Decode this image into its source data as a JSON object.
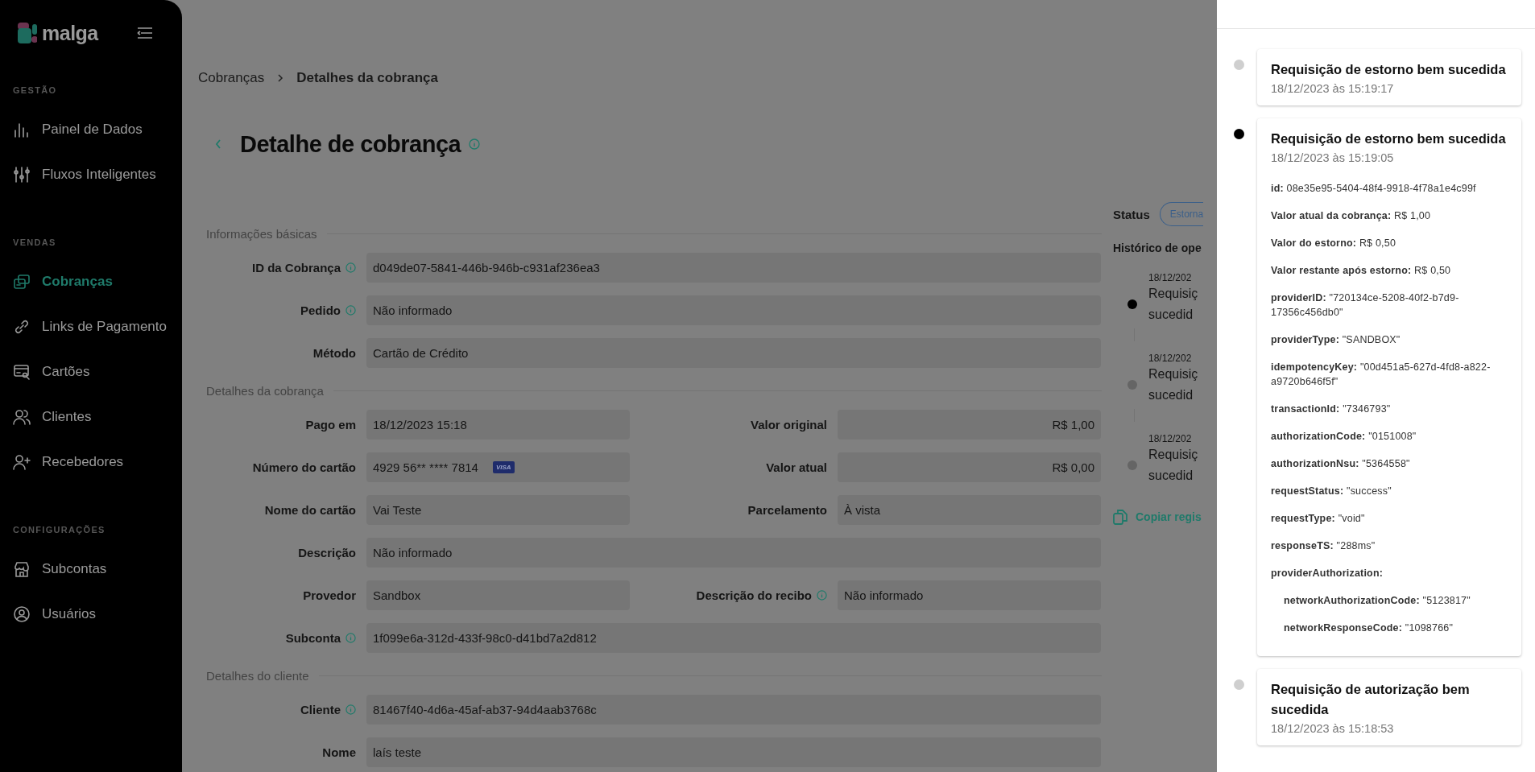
{
  "sidebar": {
    "logo": "malga",
    "sections": [
      {
        "title": "GESTÃO",
        "items": [
          {
            "label": "Painel de Dados",
            "selected": false
          },
          {
            "label": "Fluxos Inteligentes",
            "selected": false
          }
        ]
      },
      {
        "title": "VENDAS",
        "items": [
          {
            "label": "Cobranças",
            "selected": true
          },
          {
            "label": "Links de Pagamento",
            "selected": false
          },
          {
            "label": "Cartões",
            "selected": false
          },
          {
            "label": "Clientes",
            "selected": false
          },
          {
            "label": "Recebedores",
            "selected": false
          }
        ]
      },
      {
        "title": "CONFIGURAÇÕES",
        "items": [
          {
            "label": "Subcontas",
            "selected": false
          },
          {
            "label": "Usuários",
            "selected": false
          }
        ]
      }
    ]
  },
  "breadcrumb": [
    {
      "label": "Cobranças",
      "current": false
    },
    {
      "label": "Detalhes da cobrança",
      "current": true
    }
  ],
  "title": "Detalhe de cobrança",
  "sections": [
    {
      "title": "Informações básicas",
      "rows": [
        [
          {
            "label": "ID da Cobrança",
            "info": true,
            "value": "d049de07-5841-446b-946b-c931af236ea3"
          }
        ],
        [
          {
            "label": "Pedido",
            "info": true,
            "value": "Não informado"
          }
        ],
        [
          {
            "label": "Método",
            "info": false,
            "value": "Cartão de Crédito"
          }
        ]
      ]
    },
    {
      "title": "Detalhes da cobrança",
      "rows": [
        [
          {
            "label": "Pago em",
            "info": false,
            "value": "18/12/2023 15:18"
          },
          {
            "label": "Valor original",
            "info": false,
            "value": "R$ 1,00",
            "kind": "amount"
          }
        ],
        [
          {
            "label": "Número do cartão",
            "info": false,
            "value": "4929 56** **** 7814",
            "brand": "VISA"
          },
          {
            "label": "Valor atual",
            "info": false,
            "value": "R$ 0,00",
            "kind": "amount"
          }
        ],
        [
          {
            "label": "Nome do cartão",
            "info": false,
            "value": "Vai Teste"
          },
          {
            "label": "Parcelamento",
            "info": false,
            "value": "À vista"
          }
        ],
        [
          {
            "label": "Descrição",
            "info": false,
            "value": "Não informado"
          }
        ],
        [
          {
            "label": "Provedor",
            "info": false,
            "value": "Sandbox"
          },
          {
            "label": "Descrição do recibo",
            "info": true,
            "value": "Não informado"
          }
        ],
        [
          {
            "label": "Subconta",
            "info": true,
            "value": "1f099e6a-312d-433f-98c0-d41bd7a2d812"
          }
        ]
      ]
    },
    {
      "title": "Detalhes do cliente",
      "rows": [
        [
          {
            "label": "Cliente",
            "info": true,
            "value": "81467f40-4d6a-45af-ab37-94d4aab3768c"
          }
        ],
        [
          {
            "label": "Nome",
            "info": false,
            "value": "laís teste"
          }
        ]
      ]
    }
  ],
  "status": {
    "label": "Status",
    "chip": "Estorna"
  },
  "history": {
    "title": "Histórico de ope",
    "items": [
      {
        "date": "18/12/202",
        "line1": "Requisiç",
        "line2": "sucedid",
        "selected": true
      },
      {
        "date": "18/12/202",
        "line1": "Requisiç",
        "line2": "sucedid",
        "selected": false
      },
      {
        "date": "18/12/202",
        "line1": "Requisiç",
        "line2": "sucedid",
        "selected": false
      }
    ],
    "copy": "Copiar regis"
  },
  "drawer": {
    "cards": [
      {
        "title": "Requisição de estorno bem sucedida",
        "date": "18/12/2023 às 15:19:17",
        "selected": false
      },
      {
        "title": "Requisição de estorno bem sucedida",
        "date": "18/12/2023 às 15:19:05",
        "selected": true,
        "details": [
          {
            "text": "**id:** 08e35e95-5404-48f4-9918-4f78a1e4c99f"
          },
          {
            "text": "**Valor atual da cobrança:** R$ 1,00"
          },
          {
            "text": "**Valor do estorno:** R$ 0,50"
          },
          {
            "text": "**Valor restante após estorno:** R$ 0,50"
          },
          {
            "text": "**providerID:** \"720134ce-5208-40f2-b7d9-17356c456db0\""
          },
          {
            "text": "**providerType:** \"SANDBOX\""
          },
          {
            "text": "**idempotencyKey:** \"00d451a5-627d-4fd8-a822-a9720b646f5f\""
          },
          {
            "text": "**transactionId:** \"7346793\""
          },
          {
            "text": "**authorizationCode:** \"0151008\""
          },
          {
            "text": "**authorizationNsu:** \"5364558\""
          },
          {
            "text": "**requestStatus:** \"success\""
          },
          {
            "text": "**requestType:** \"void\""
          },
          {
            "text": "**responseTS:** \"288ms\""
          },
          {
            "text": "**providerAuthorization:**",
            "children": [
              {
                "text": "**networkAuthorizationCode:** \"5123817\""
              },
              {
                "text": "**networkResponseCode:** \"1098766\""
              }
            ]
          }
        ]
      },
      {
        "title": "Requisição de autorização bem sucedida",
        "date": "18/12/2023 às 15:18:53",
        "selected": false
      }
    ]
  }
}
